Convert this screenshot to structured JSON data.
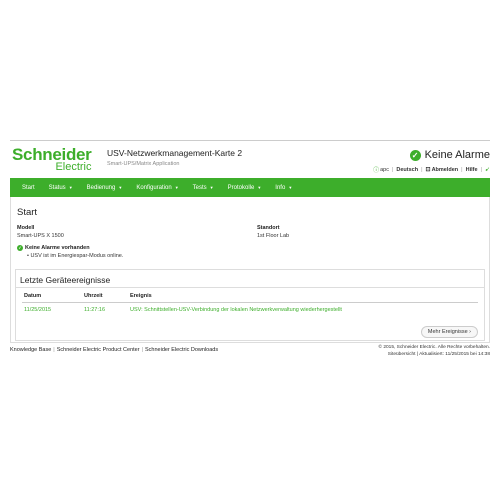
{
  "header": {
    "logo_top": "Schneider",
    "logo_bottom": "Electric",
    "app_title": "USV-Netzwerkmanagement-Karte 2",
    "app_subtitle": "Smart-UPS/Matrix Application",
    "alarm_status": "Keine Alarme",
    "utility": {
      "user": "apc",
      "language": "Deutsch",
      "logout": "Abmelden",
      "help": "Hilfe"
    }
  },
  "nav": {
    "items": [
      {
        "label": "Start",
        "has_menu": false
      },
      {
        "label": "Status",
        "has_menu": true
      },
      {
        "label": "Bedienung",
        "has_menu": true
      },
      {
        "label": "Konfiguration",
        "has_menu": true
      },
      {
        "label": "Tests",
        "has_menu": true
      },
      {
        "label": "Protokolle",
        "has_menu": true
      },
      {
        "label": "Info",
        "has_menu": true
      }
    ]
  },
  "main": {
    "title": "Start",
    "model_label": "Modell",
    "model_value": "Smart-UPS X 1500",
    "location_label": "Standort",
    "location_value": "1st Floor Lab",
    "status_title": "Keine Alarme vorhanden",
    "status_detail": "• USV ist im Energiespar-Modus online."
  },
  "events": {
    "title": "Letzte Geräteereignisse",
    "columns": [
      "Datum",
      "Uhrzeit",
      "Ereignis"
    ],
    "rows": [
      {
        "date": "11/25/2015",
        "time": "11:27:16",
        "event": "USV: Schnittstellen-USV-Verbindung der lokalen Netzwerkverwaltung wiederhergestellt"
      }
    ],
    "more_button": "Mehr Ereignisse ›"
  },
  "footer": {
    "links": [
      "Knowledge Base",
      "Schneider Electric Product Center",
      "Schneider Electric Downloads"
    ],
    "copyright": "© 2015, Schneider Electric. Alle Rechte vorbehalten.",
    "sitemap": "Siteübersicht",
    "updated": "Aktualisiert: 11/25/2015 bei 14:38"
  },
  "colors": {
    "brand_green": "#3dae2b"
  }
}
